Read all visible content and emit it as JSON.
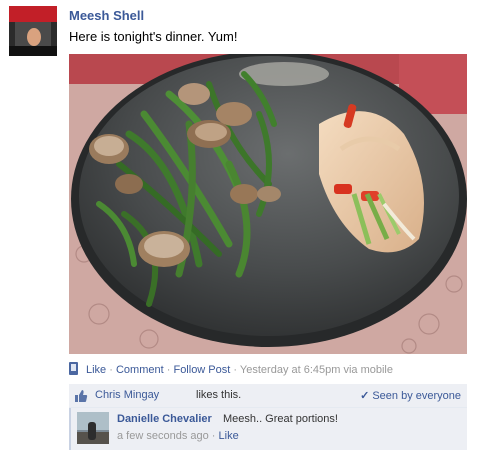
{
  "post": {
    "author": "Meesh Shell",
    "message": "Here is tonight's dinner. Yum!"
  },
  "actions": {
    "like": "Like",
    "comment": "Comment",
    "follow": "Follow Post",
    "separator": "·",
    "timestamp": "Yesterday at 6:45pm via mobile"
  },
  "likes": {
    "liker": "Chris Mingay",
    "suffix": "likes this.",
    "seen": "Seen by everyone"
  },
  "comment": {
    "author": "Danielle Chevalier",
    "text": "Meesh.. Great portions!",
    "time": "a few seconds ago",
    "separator": "·",
    "like": "Like"
  },
  "icons": {
    "mobile": "mobile-phone-icon",
    "thumb": "thumbs-up-icon",
    "seen": "checkmark-icon"
  },
  "colors": {
    "link": "#3b5998",
    "muted": "#999999",
    "panel": "#edeff4"
  }
}
